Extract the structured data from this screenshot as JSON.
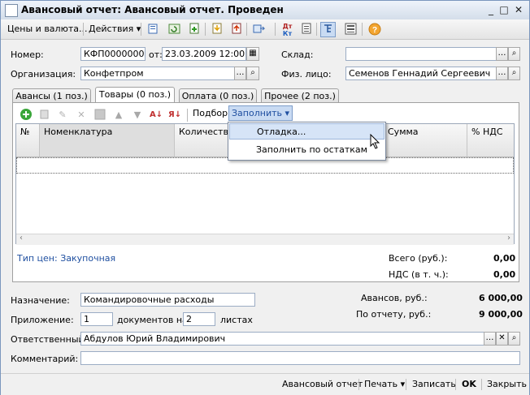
{
  "window": {
    "title": "Авансовый отчет: Авансовый отчет. Проведен",
    "min": "_",
    "max": "□",
    "close": "✕"
  },
  "toolbar": {
    "prices_label": "Цены и валюта...",
    "actions_label": "Действия ▾",
    "help": "?"
  },
  "header": {
    "number_label": "Номер:",
    "number_value": "КФП00000002",
    "date_label": "от:",
    "date_value": "23.03.2009 12:00:01",
    "warehouse_label": "Склад:",
    "warehouse_value": "",
    "org_label": "Организация:",
    "org_value": "Конфетпром",
    "person_label": "Физ. лицо:",
    "person_value": "Семенов Геннадий Сергеевич"
  },
  "tabs": [
    {
      "label": "Авансы (1 поз.)"
    },
    {
      "label": "Товары (0 поз.)"
    },
    {
      "label": "Оплата (0 поз.)"
    },
    {
      "label": "Прочее (2 поз.)"
    }
  ],
  "panel_toolbar": {
    "pick_label": "Подбор",
    "fill_label": "Заполнить ▾"
  },
  "grid": {
    "columns": [
      "№",
      "Номенклатура",
      "Количество",
      "Сумма",
      "% НДС"
    ]
  },
  "dropdown": {
    "items": [
      "Отладка...",
      "Заполнить по остаткам"
    ]
  },
  "price_type": "Тип цен: Закупочная",
  "totals": {
    "total_label": "Всего (руб.):",
    "total_value": "0,00",
    "vat_label": "НДС (в т. ч.):",
    "vat_value": "0,00"
  },
  "footer": {
    "purpose_label": "Назначение:",
    "purpose_value": "Командировочные расходы",
    "attach_label": "Приложение:",
    "attach_count": "1",
    "docs_label": "документов на",
    "sheets_count": "2",
    "sheets_label": "листах",
    "advances_label": "Авансов, руб.:",
    "advances_value": "6 000,00",
    "report_label": "По отчету, руб.:",
    "report_value": "9 000,00",
    "resp_label": "Ответственный:",
    "resp_value": "Абдулов Юрий Владимирович",
    "comment_label": "Комментарий:",
    "comment_value": ""
  },
  "bottom": {
    "report_btn": "Авансовый отчет",
    "print_btn": "Печать ▾",
    "write_btn": "Записать",
    "ok_btn": "OK",
    "close_btn": "Закрыть"
  },
  "colors": {
    "accent": "#1e4f9c",
    "link": "#1f4fa0"
  }
}
